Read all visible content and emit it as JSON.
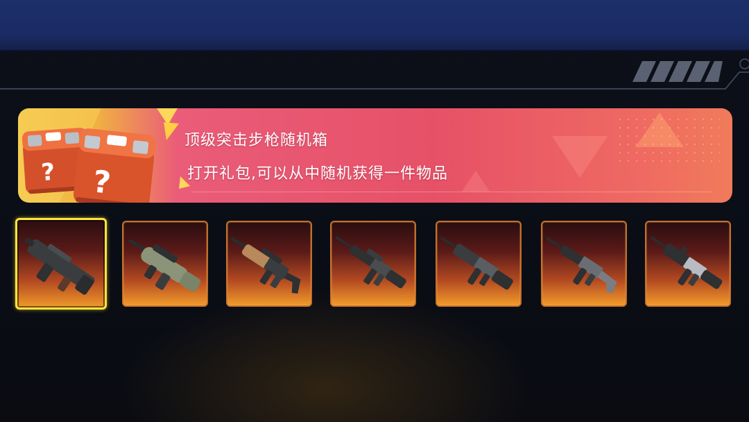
{
  "banner": {
    "title": "顶级突击步枪随机箱",
    "description": "打开礼包,可以从中随机获得一件物品"
  },
  "items": [
    {
      "icon": "bullpup-smg-icon",
      "selected": true
    },
    {
      "icon": "aug-rifle-icon",
      "selected": false
    },
    {
      "icon": "tan-assault-rifle-icon",
      "selected": false
    },
    {
      "icon": "m4-carbine-icon",
      "selected": false
    },
    {
      "icon": "akm-rifle-icon",
      "selected": false
    },
    {
      "icon": "ak-rifle-icon",
      "selected": false
    },
    {
      "icon": "m16-rifle-icon",
      "selected": false
    }
  ],
  "colors": {
    "selected_border": "#ffe53a",
    "slot_border": "#c56f2a",
    "banner_pink": "#e65167",
    "topbar_blue": "#1d2f6a"
  }
}
